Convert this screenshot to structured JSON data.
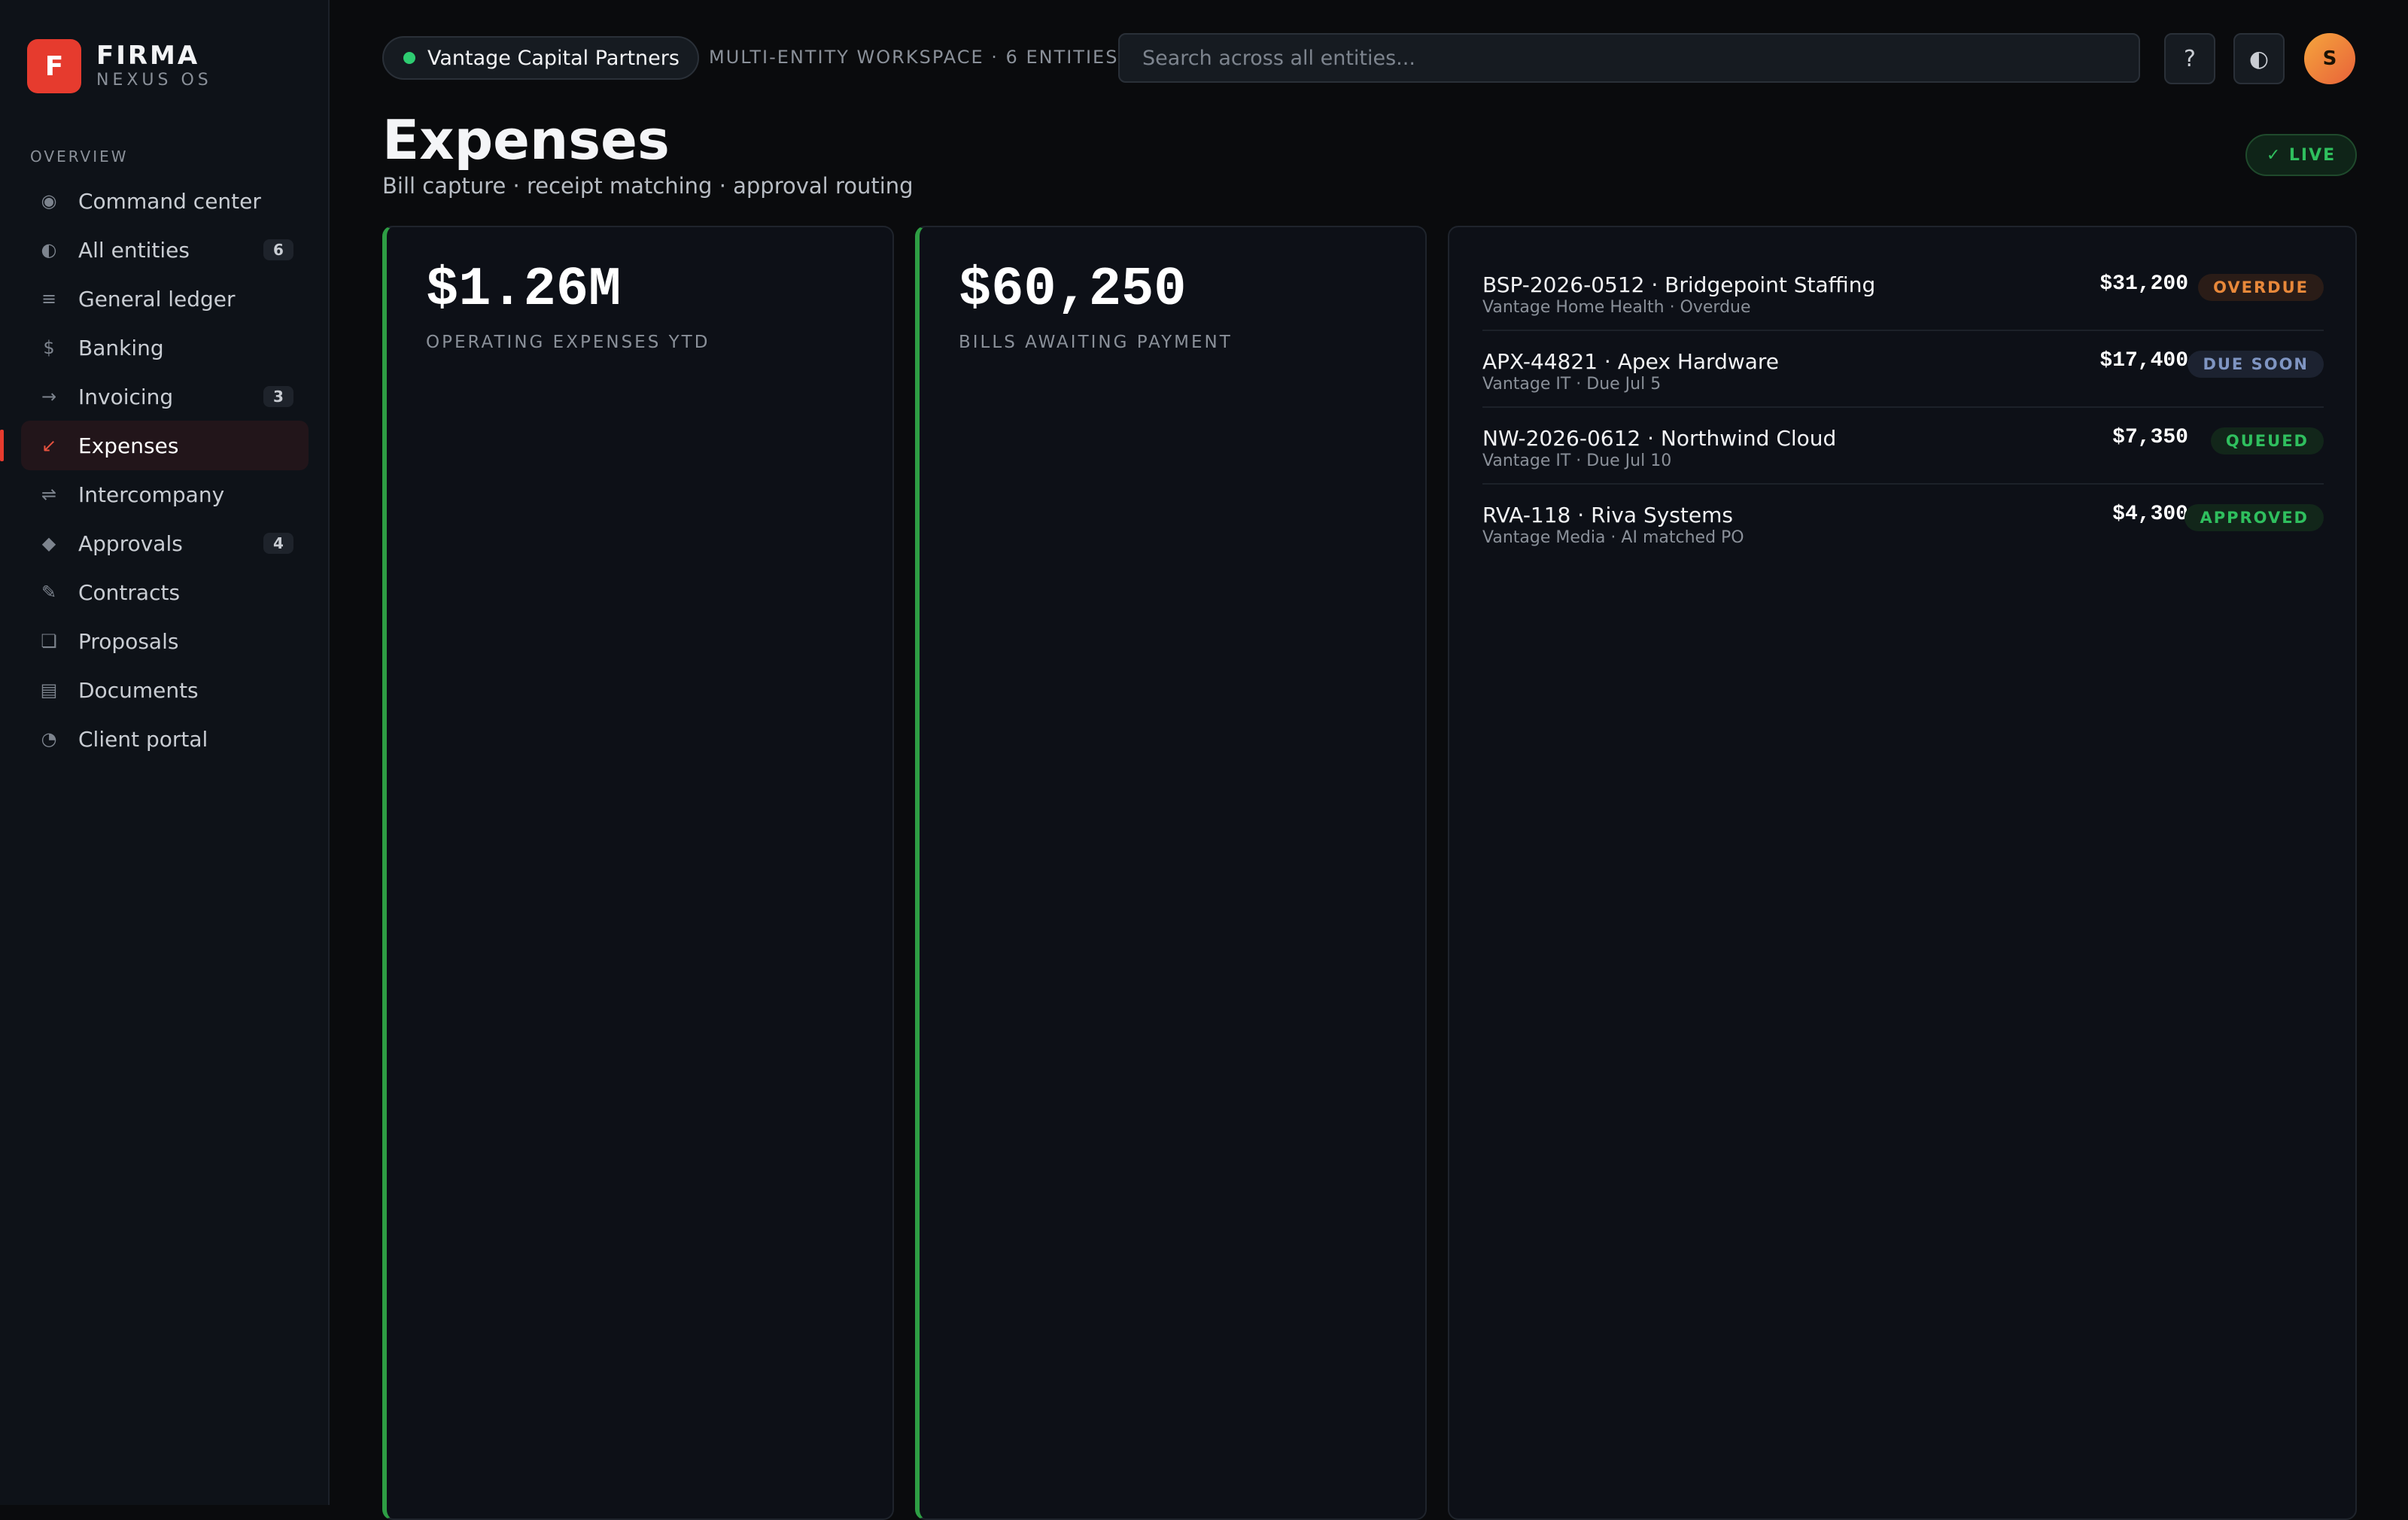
{
  "brand": {
    "logo_letter": "F",
    "name": "FIRMA",
    "sub": "NEXUS OS"
  },
  "sidebar": {
    "section_label": "OVERVIEW",
    "items": [
      {
        "label": "Command center",
        "icon": "◉",
        "icon_name": "target-icon",
        "badge": ""
      },
      {
        "label": "All entities",
        "icon": "◐",
        "icon_name": "half-circle-icon",
        "badge": "6"
      },
      {
        "label": "General ledger",
        "icon": "≡",
        "icon_name": "ledger-icon",
        "badge": ""
      },
      {
        "label": "Banking",
        "icon": "$",
        "icon_name": "dollar-icon",
        "badge": ""
      },
      {
        "label": "Invoicing",
        "icon": "→",
        "icon_name": "arrow-right-icon",
        "badge": "3"
      },
      {
        "label": "Expenses",
        "icon": "↙",
        "icon_name": "arrow-down-left-icon",
        "badge": "",
        "active": true
      },
      {
        "label": "Intercompany",
        "icon": "⇌",
        "icon_name": "exchange-icon",
        "badge": ""
      },
      {
        "label": "Approvals",
        "icon": "◆",
        "icon_name": "diamond-icon",
        "badge": "4"
      },
      {
        "label": "Contracts",
        "icon": "✎",
        "icon_name": "pencil-icon",
        "badge": ""
      },
      {
        "label": "Proposals",
        "icon": "❏",
        "icon_name": "proposal-icon",
        "badge": ""
      },
      {
        "label": "Documents",
        "icon": "▤",
        "icon_name": "document-icon",
        "badge": ""
      },
      {
        "label": "Client portal",
        "icon": "◔",
        "icon_name": "portal-icon",
        "badge": ""
      }
    ]
  },
  "topbar": {
    "entity": "Vantage Capital Partners",
    "workspace": "MULTI-ENTITY WORKSPACE · 6 ENTITIES",
    "search_placeholder": "Search across all entities...",
    "help_icon": "?",
    "theme_icon": "◐",
    "avatar_initial": "S"
  },
  "page": {
    "title": "Expenses",
    "subtitle": "Bill capture · receipt matching · approval routing",
    "live_badge": "✓ LIVE"
  },
  "kpis": [
    {
      "value": "$1.26M",
      "label": "OPERATING EXPENSES YTD"
    },
    {
      "value": "$60,250",
      "label": "BILLS AWAITING PAYMENT"
    }
  ],
  "bills": [
    {
      "title": "BSP-2026-0512 · Bridgepoint Staffing",
      "sub": "Vantage Home Health · Overdue",
      "amount": "$31,200",
      "status": "OVERDUE",
      "status_color": "#e8883a"
    },
    {
      "title": "APX-44821 · Apex Hardware",
      "sub": "Vantage IT · Due Jul 5",
      "amount": "$17,400",
      "status": "DUE SOON",
      "status_color": "#7f95c2"
    },
    {
      "title": "NW-2026-0612 · Northwind Cloud",
      "sub": "Vantage IT · Due Jul 10",
      "amount": "$7,350",
      "status": "QUEUED",
      "status_color": "#2fbf5e"
    },
    {
      "title": "RVA-118 · Riva Systems",
      "sub": "Vantage Media · AI matched PO",
      "amount": "$4,300",
      "status": "APPROVED",
      "status_color": "#2fbf5e"
    }
  ],
  "colors": {
    "accent": "#e63b2e",
    "kpi_border": "#2e9e44",
    "live": "#2fbf5e"
  }
}
